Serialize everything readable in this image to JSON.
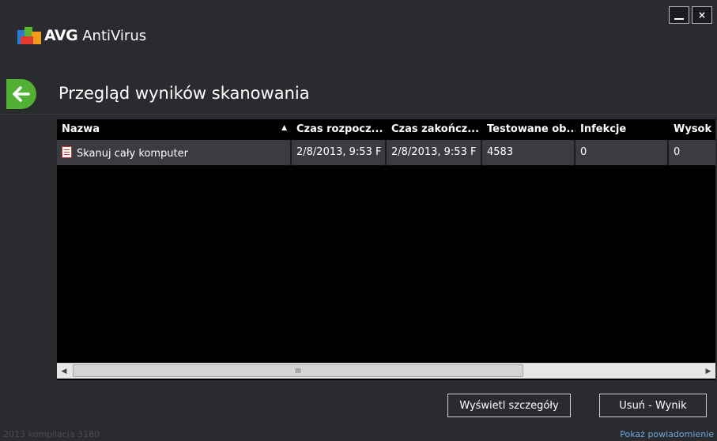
{
  "app": {
    "brand": "AVG",
    "name": "AntiVirus"
  },
  "window": {
    "minimize": "_",
    "close": "×"
  },
  "page": {
    "title": "Przegląd wyników skanowania"
  },
  "table": {
    "columns": [
      "Nazwa",
      "Czas rozpocz...",
      "Czas zakończ...",
      "Testowane ob...",
      "Infekcje",
      "Wysok"
    ],
    "sort_indicator": "▲",
    "rows": [
      {
        "name": "Skanuj cały komputer",
        "start": "2/8/2013, 9:53 F",
        "end": "2/8/2013, 9:53 F",
        "tested": "4583",
        "infections": "0",
        "high": "0"
      }
    ]
  },
  "scrollbar": {
    "left": "◀",
    "right": "▶",
    "grip": "III"
  },
  "buttons": {
    "details": "Wyświetl szczegóły",
    "delete": "Usuń - Wynik"
  },
  "footer": {
    "build": "2013  kompilacja 3180",
    "notifications": "Pokaż powiadomienie"
  },
  "colors": {
    "accent": "#52b035",
    "background": "#2a2b2f",
    "table_bg": "#000000",
    "row_bg": "#3b3c40",
    "link": "#6fa8dc"
  },
  "icons": {
    "back": "arrow-left-icon",
    "row": "report-document-icon"
  }
}
